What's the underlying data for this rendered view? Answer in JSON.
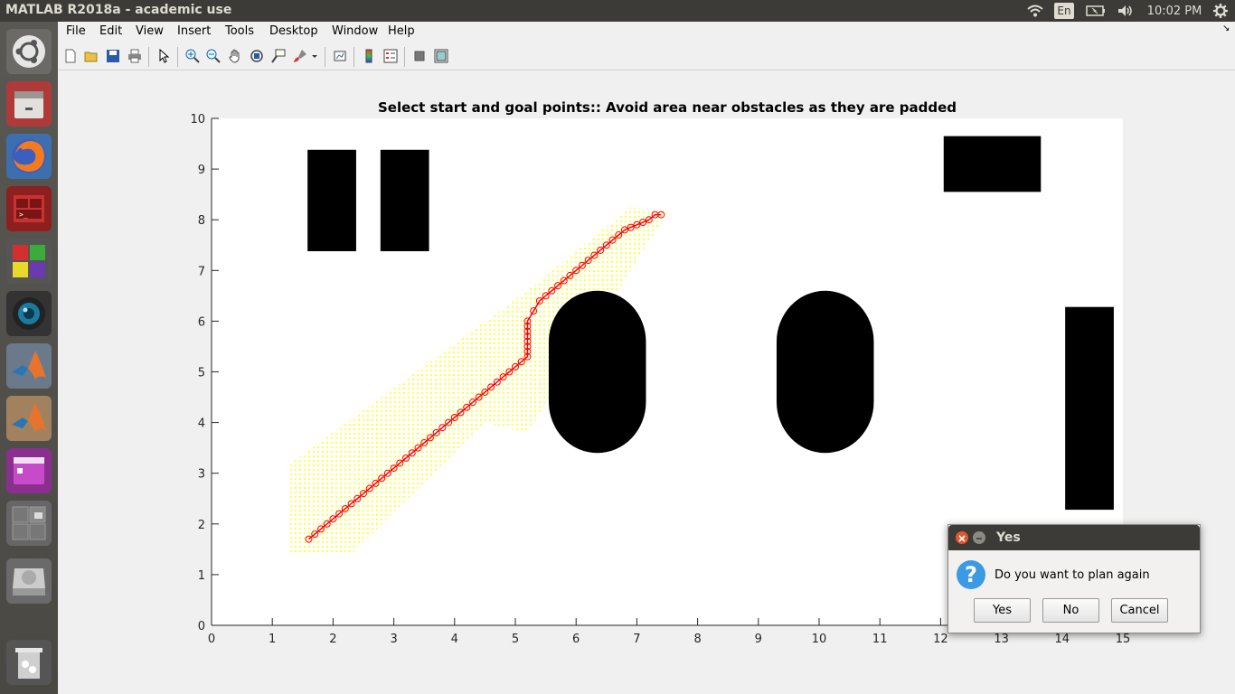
{
  "window_title": "MATLAB R2018a - academic use",
  "panel": {
    "lang": "En",
    "time": "10:02 PM"
  },
  "menu": [
    "File",
    "Edit",
    "View",
    "Insert",
    "Tools",
    "Desktop",
    "Window",
    "Help"
  ],
  "plot": {
    "title": "Select start and goal points:: Avoid area near obstacles as they are padded"
  },
  "chart_data": {
    "type": "scatter",
    "title": "Select start and goal points:: Avoid area near obstacles as they are padded",
    "xlabel": "",
    "ylabel": "",
    "xlim": [
      0,
      15
    ],
    "ylim": [
      0,
      10
    ],
    "xticks": [
      0,
      1,
      2,
      3,
      4,
      5,
      6,
      7,
      8,
      9,
      10,
      11,
      12,
      13,
      14,
      15
    ],
    "yticks": [
      0,
      1,
      2,
      3,
      4,
      5,
      6,
      7,
      8,
      9,
      10
    ],
    "grid": false,
    "obstacles": [
      {
        "shape": "rect",
        "x": [
          1.58,
          2.38
        ],
        "y": [
          7.38,
          9.38
        ]
      },
      {
        "shape": "rect",
        "x": [
          2.78,
          3.58
        ],
        "y": [
          7.38,
          9.38
        ]
      },
      {
        "shape": "rect",
        "x": [
          12.05,
          13.65
        ],
        "y": [
          8.55,
          9.65
        ]
      },
      {
        "shape": "rect",
        "x": [
          14.05,
          14.85
        ],
        "y": [
          2.28,
          6.28
        ]
      },
      {
        "shape": "capsule",
        "x": [
          5.55,
          7.15
        ],
        "y": [
          3.4,
          6.6
        ]
      },
      {
        "shape": "capsule",
        "x": [
          9.3,
          10.9
        ],
        "y": [
          3.4,
          6.6
        ]
      }
    ],
    "explored_region_color": "#ffff00",
    "path_color": "#ff0000",
    "path": [
      [
        1.6,
        1.7
      ],
      [
        1.7,
        1.8
      ],
      [
        1.8,
        1.9
      ],
      [
        1.9,
        2.0
      ],
      [
        2.0,
        2.1
      ],
      [
        2.1,
        2.2
      ],
      [
        2.2,
        2.3
      ],
      [
        2.3,
        2.4
      ],
      [
        2.4,
        2.5
      ],
      [
        2.5,
        2.6
      ],
      [
        2.6,
        2.7
      ],
      [
        2.7,
        2.8
      ],
      [
        2.8,
        2.9
      ],
      [
        2.9,
        3.0
      ],
      [
        3.0,
        3.1
      ],
      [
        3.1,
        3.2
      ],
      [
        3.2,
        3.3
      ],
      [
        3.3,
        3.4
      ],
      [
        3.4,
        3.5
      ],
      [
        3.5,
        3.6
      ],
      [
        3.6,
        3.7
      ],
      [
        3.7,
        3.8
      ],
      [
        3.8,
        3.9
      ],
      [
        3.9,
        4.0
      ],
      [
        4.0,
        4.1
      ],
      [
        4.1,
        4.2
      ],
      [
        4.2,
        4.3
      ],
      [
        4.3,
        4.4
      ],
      [
        4.4,
        4.5
      ],
      [
        4.5,
        4.6
      ],
      [
        4.6,
        4.7
      ],
      [
        4.7,
        4.8
      ],
      [
        4.8,
        4.9
      ],
      [
        4.9,
        5.0
      ],
      [
        5.0,
        5.1
      ],
      [
        5.1,
        5.2
      ],
      [
        5.2,
        5.3
      ],
      [
        5.2,
        5.4
      ],
      [
        5.2,
        5.5
      ],
      [
        5.2,
        5.6
      ],
      [
        5.2,
        5.7
      ],
      [
        5.2,
        5.8
      ],
      [
        5.2,
        5.9
      ],
      [
        5.2,
        6.0
      ],
      [
        5.3,
        6.2
      ],
      [
        5.4,
        6.4
      ],
      [
        5.5,
        6.5
      ],
      [
        5.6,
        6.6
      ],
      [
        5.7,
        6.7
      ],
      [
        5.8,
        6.8
      ],
      [
        5.9,
        6.9
      ],
      [
        6.0,
        7.0
      ],
      [
        6.1,
        7.1
      ],
      [
        6.2,
        7.2
      ],
      [
        6.3,
        7.3
      ],
      [
        6.4,
        7.4
      ],
      [
        6.5,
        7.5
      ],
      [
        6.6,
        7.6
      ],
      [
        6.7,
        7.7
      ],
      [
        6.8,
        7.8
      ],
      [
        6.9,
        7.85
      ],
      [
        7.0,
        7.9
      ],
      [
        7.1,
        7.95
      ],
      [
        7.2,
        8.0
      ],
      [
        7.3,
        8.1
      ],
      [
        7.4,
        8.1
      ]
    ]
  },
  "dialog": {
    "title": "Yes",
    "message": "Do you want to plan again",
    "buttons": [
      "Yes",
      "No",
      "Cancel"
    ]
  }
}
